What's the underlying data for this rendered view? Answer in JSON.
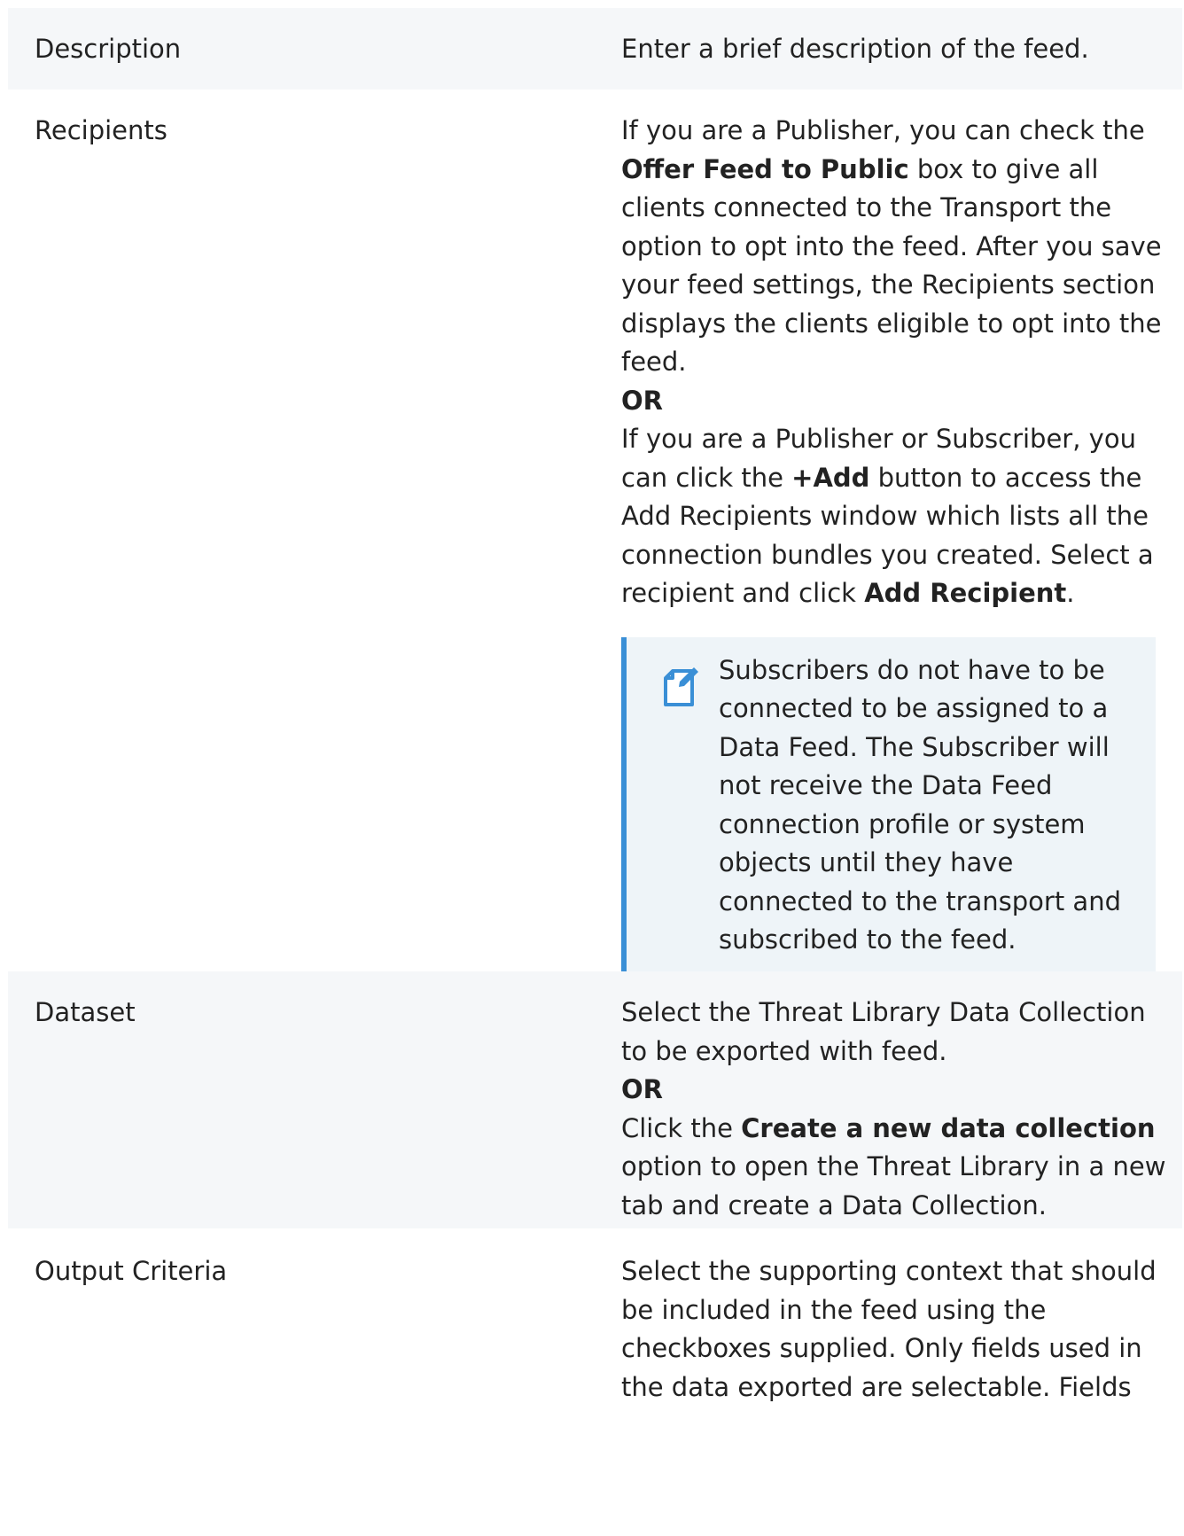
{
  "rows": [
    {
      "label": "Description",
      "text": "Enter a brief description of the feed."
    },
    {
      "label": "Recipients",
      "p1_a": "If you are a Publisher, you can check the ",
      "p1_b": "Offer Feed to Public",
      "p1_c": " box to give all clients connected to the Transport the option to opt into the feed. After you save your feed settings, the Recipients section displays the clients eligible to opt into the feed.",
      "or": "OR",
      "p2_a": "If you are a Publisher or Subscriber, you can click the ",
      "p2_b": "+Add",
      "p2_c": " button to access the Add Recipients window which lists all the connection bundles you created. Select a recipient and click ",
      "p2_d": "Add Recipient",
      "p2_e": ".",
      "note_icon": "note-edit-icon",
      "note": "Subscribers do not have to be connected to be assigned to a Data Feed.  The Subscriber will not receive the Data Feed connection profile or system objects until they have connected to the transport and subscribed to the feed."
    },
    {
      "label": "Dataset",
      "p1": "Select the Threat Library Data Collection to be exported with feed.",
      "or": "OR",
      "p2_a": "Click the ",
      "p2_b": "Create a new data collection",
      "p2_c": " option to open the Threat Library in a new tab and create a Data Collection."
    },
    {
      "label": "Output Criteria",
      "text": "Select the supporting context that should be included in the feed using the checkboxes supplied. Only fields used in the data exported are selectable. Fields"
    }
  ],
  "colors": {
    "shaded_row": "#f5f7f9",
    "note_background": "#eef4f8",
    "note_border": "#3a8fd6",
    "icon": "#3a8fd6"
  }
}
